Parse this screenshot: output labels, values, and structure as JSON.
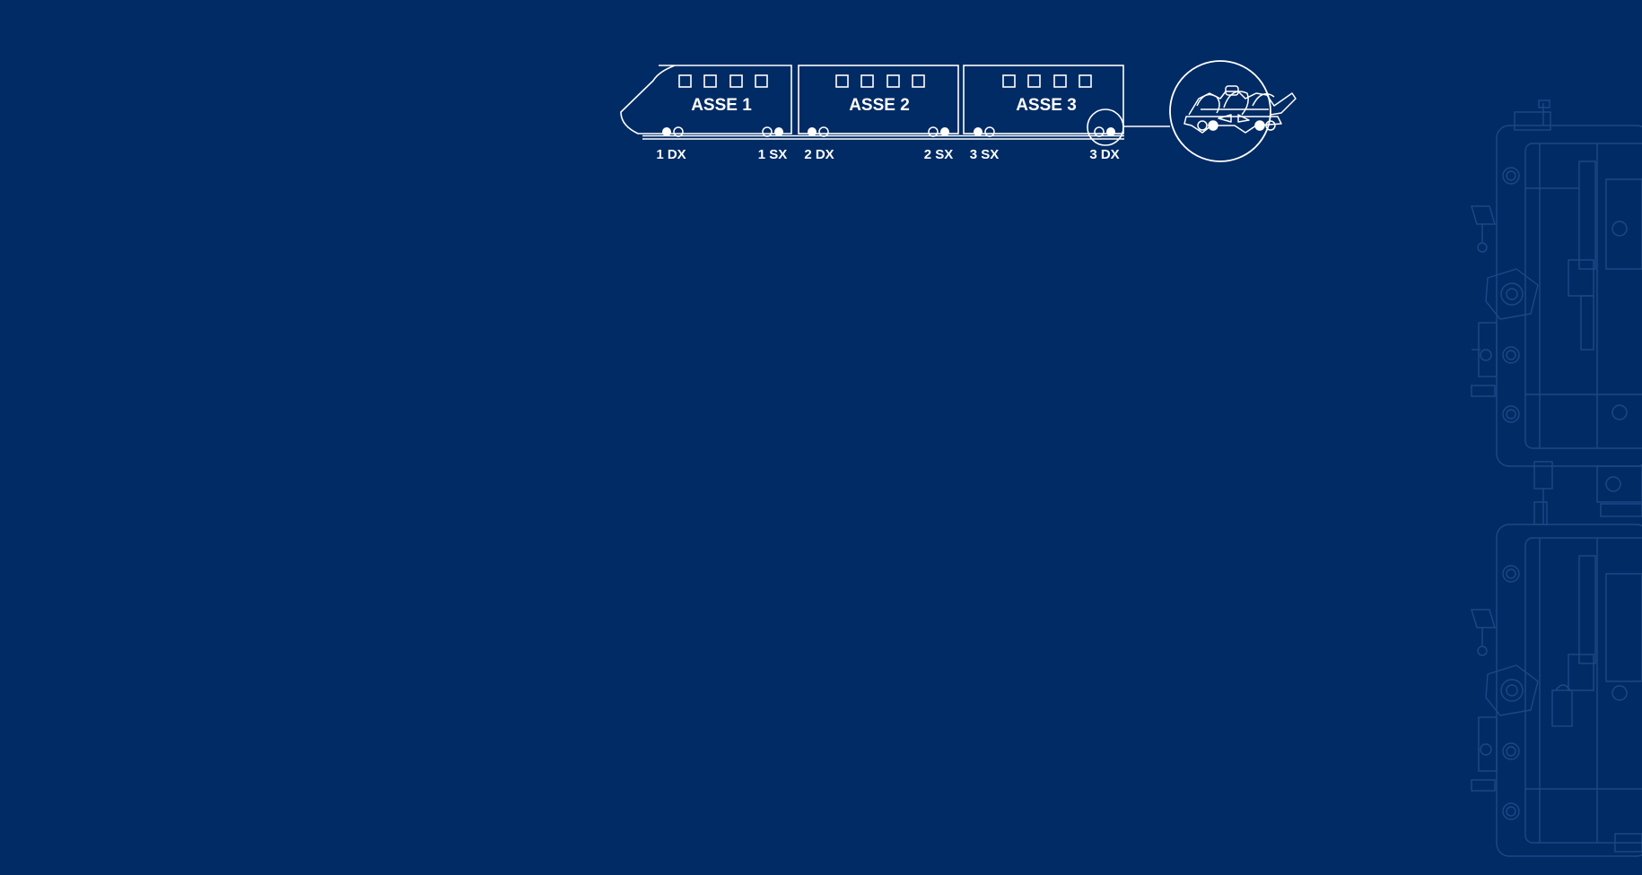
{
  "train": {
    "cars": [
      {
        "label": "ASSE 1",
        "left_wheel": "1 DX",
        "right_wheel": "1 SX"
      },
      {
        "label": "ASSE 2",
        "left_wheel": "2 DX",
        "right_wheel": "2 SX"
      },
      {
        "label": "ASSE 3",
        "left_wheel": "3 SX",
        "right_wheel": "3 DX"
      }
    ],
    "highlighted_wheel": "3 DX"
  },
  "colors": {
    "background": "#012b64",
    "line": "#ffffff",
    "blueprint": "#1e4a88"
  },
  "icons": {
    "zoom": "bogie-detail-icon",
    "background": "machine-blueprint-icon"
  }
}
